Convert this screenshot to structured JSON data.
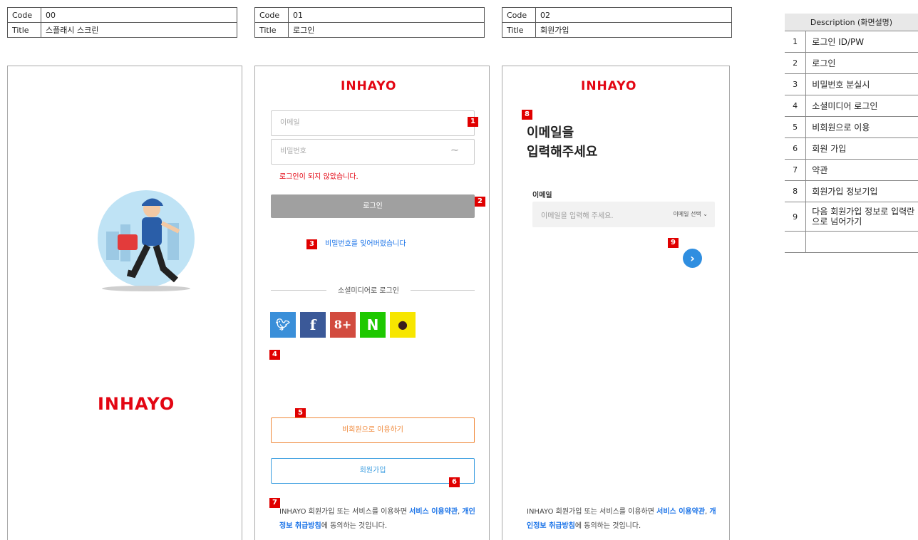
{
  "screens": [
    {
      "code_label": "Code",
      "code": "00",
      "title_label": "Title",
      "title": "스플래시 스크린"
    },
    {
      "code_label": "Code",
      "code": "01",
      "title_label": "Title",
      "title": "로그인"
    },
    {
      "code_label": "Code",
      "code": "02",
      "title_label": "Title",
      "title": "회원가입"
    }
  ],
  "splash": {
    "logo": "INHAYO"
  },
  "login": {
    "logo": "INHAYO",
    "email_placeholder": "이메일",
    "password_placeholder": "비밀번호",
    "error_message": "로그인이 되지 않았습니다.",
    "login_button": "로그인",
    "forgot_password": "비밀번호를 잊어버렸습니다",
    "social_header": "소셜미디어로 로그인",
    "social_icons": [
      "twitter-icon",
      "facebook-icon",
      "google-plus-icon",
      "naver-icon",
      "kakaotalk-icon"
    ],
    "guest_button": "비회원으로 이용하기",
    "signup_button": "회원가입",
    "terms_prefix": "INHAYO 회원가입 또는 서비스를 이용하면 ",
    "terms_link1": "서비스 이용약관",
    "terms_sep": ", ",
    "terms_link2": "개인정보 취급방침",
    "terms_suffix": "에 동의하는 것입니다."
  },
  "signup": {
    "logo": "INHAYO",
    "heading_line1": "이메일을",
    "heading_line2": "입력해주세요",
    "email_label": "이메일",
    "email_placeholder": "이메일을 입력해 주세요.",
    "email_select": "이메일 선택",
    "terms_prefix": "INHAYO 회원가입 또는 서비스를 이용하면 ",
    "terms_link1": "서비스 이용약관",
    "terms_sep": ", ",
    "terms_link2": "개인정보 취급방침",
    "terms_suffix": "에 동의하는 것입니다."
  },
  "markers": [
    "1",
    "2",
    "3",
    "4",
    "5",
    "6",
    "7",
    "8",
    "9"
  ],
  "description": {
    "header": "Description (화면설명)",
    "rows": [
      {
        "n": "1",
        "t": "로그인 ID/PW"
      },
      {
        "n": "2",
        "t": "로그인"
      },
      {
        "n": "3",
        "t": "비밀번호 분실시"
      },
      {
        "n": "4",
        "t": "소셜미디어 로그인"
      },
      {
        "n": "5",
        "t": "비회원으로 이용"
      },
      {
        "n": "6",
        "t": "회원 가입"
      },
      {
        "n": "7",
        "t": "약관"
      },
      {
        "n": "8",
        "t": "회원가입 정보기입"
      },
      {
        "n": "9",
        "t": "다음 회원가입 정보로 입력란으로 넘어가기"
      }
    ]
  },
  "colors": {
    "brand": "#e30613",
    "marker": "#e00000",
    "link": "#1a73e8",
    "guest": "#f08a3c",
    "signup": "#3a9de0"
  }
}
